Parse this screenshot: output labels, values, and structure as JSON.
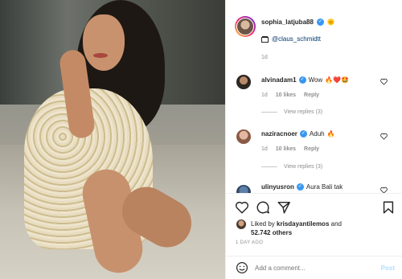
{
  "post": {
    "author": "sophia_latjuba88",
    "tag": "@claus_schmidtt",
    "time_ago": "1d",
    "date_label": "1 DAY AGO"
  },
  "comments": [
    {
      "user": "alvinadam1",
      "text": "Wow",
      "emoji": "🔥❤️🤩",
      "time": "1d",
      "likes": "10 likes",
      "reply": "Reply",
      "view_replies": "View replies (3)"
    },
    {
      "user": "naziracnoer",
      "text": "Aduh",
      "emoji": "🔥",
      "time": "1d",
      "likes": "10 likes",
      "reply": "Reply",
      "view_replies": "View replies (3)"
    },
    {
      "user": "ulinyusron",
      "text": "Aura Bali tak"
    }
  ],
  "likes": {
    "prefix": "Liked by",
    "user": "krisdayantilemos",
    "and": "and",
    "count": "52.742 others"
  },
  "add_comment": {
    "placeholder": "Add a comment...",
    "post_label": "Post"
  },
  "icons": {
    "tag": "film-tag-icon",
    "sun": "sun-emoji",
    "like": "heart-icon",
    "comment": "comment-icon",
    "share": "share-icon",
    "save": "bookmark-icon",
    "emoji": "smiley-icon"
  }
}
